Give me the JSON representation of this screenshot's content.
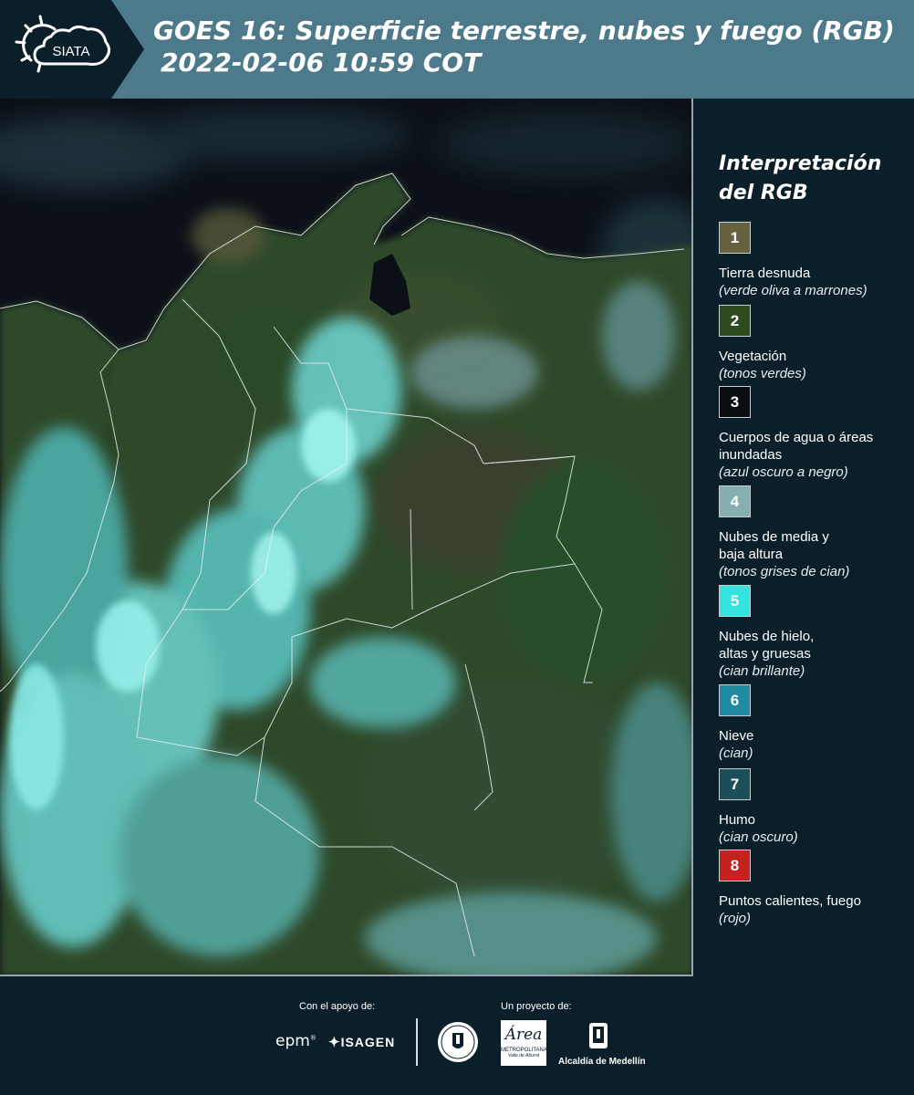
{
  "header": {
    "logo_text": "SIATA",
    "title_line1": "GOES 16: Superficie terrestre, nubes y fuego (RGB)",
    "title_line2": "2022-02-06 10:59 COT"
  },
  "legend": {
    "title": "Interpretación del RGB",
    "items": [
      {
        "number": "1",
        "label": "Tierra desnuda",
        "sub": "(verde oliva a marrones)",
        "color": "#66613f"
      },
      {
        "number": "2",
        "label": "Vegetación",
        "sub": "(tonos verdes)",
        "color": "#2e4a1f"
      },
      {
        "number": "3",
        "label": "Cuerpos de agua o áreas inundadas",
        "sub": "(azul oscuro a negro)",
        "color": "#0a0d12"
      },
      {
        "number": "4",
        "label": "Nubes de media y baja altura",
        "sub": "(tonos grises de cian)",
        "color": "#86afb0"
      },
      {
        "number": "5",
        "label": "Nubes de hielo, altas y gruesas",
        "sub": "(cian brillante)",
        "color": "#33e3e0"
      },
      {
        "number": "6",
        "label": "Nieve",
        "sub": "(cian)",
        "color": "#1f8aa1"
      },
      {
        "number": "7",
        "label": "Humo",
        "sub": "(cian oscuro)",
        "color": "#1d4f59"
      },
      {
        "number": "8",
        "label": "Puntos calientes, fuego",
        "sub": "(rojo)",
        "color": "#c42121"
      }
    ]
  },
  "footer": {
    "support_label": "Con el apoyo de:",
    "project_label": "Un proyecto de:",
    "epm": "epm",
    "isagen": "ISAGEN",
    "metropolitana": "METROPOLITANA",
    "area": "Área",
    "valle": "Valle de Aburrá",
    "alcaldia": "Alcaldía de Medellín"
  }
}
